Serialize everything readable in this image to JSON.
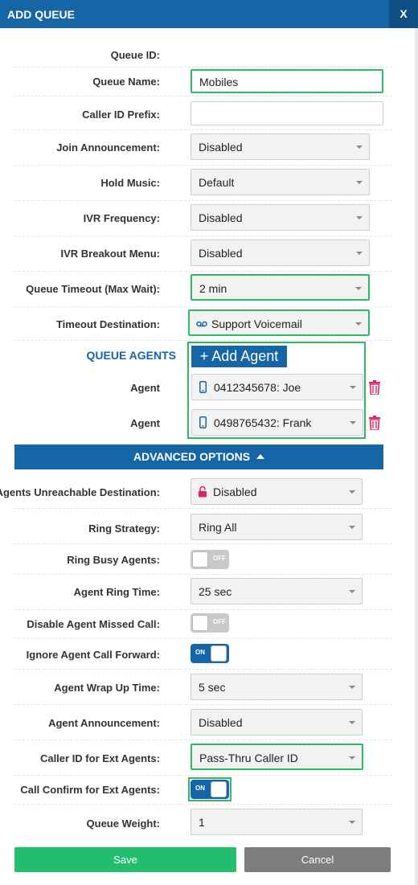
{
  "dialog": {
    "title": "ADD QUEUE",
    "close_label": "X"
  },
  "fields": {
    "queue_id": {
      "label": "Queue ID:"
    },
    "queue_name": {
      "label": "Queue Name:",
      "value": "Mobiles"
    },
    "caller_id_prefix": {
      "label": "Caller ID Prefix:",
      "value": ""
    },
    "join_announcement": {
      "label": "Join Announcement:",
      "value": "Disabled"
    },
    "hold_music": {
      "label": "Hold Music:",
      "value": "Default"
    },
    "ivr_frequency": {
      "label": "IVR Frequency:",
      "value": "Disabled"
    },
    "ivr_breakout_menu": {
      "label": "IVR Breakout Menu:",
      "value": "Disabled"
    },
    "queue_timeout": {
      "label": "Queue Timeout (Max Wait):",
      "value": "2 min"
    },
    "timeout_destination": {
      "label": "Timeout Destination:",
      "value": "Support Voicemail",
      "icon": "voicemail-icon"
    }
  },
  "agents": {
    "title": "QUEUE AGENTS",
    "add_label": "+ Add Agent",
    "list": [
      {
        "label": "Agent",
        "value": "0412345678: Joe",
        "icon": "mobile-phone-icon"
      },
      {
        "label": "Agent",
        "value": "0498765432: Frank",
        "icon": "mobile-phone-icon"
      }
    ]
  },
  "advanced": {
    "title": "ADVANCED OPTIONS",
    "agents_unreachable": {
      "label": "Agents Unreachable Destination:",
      "value": "Disabled",
      "icon": "lock-icon"
    },
    "ring_strategy": {
      "label": "Ring Strategy:",
      "value": "Ring All"
    },
    "ring_busy_agents": {
      "label": "Ring Busy Agents:",
      "state": "OFF"
    },
    "agent_ring_time": {
      "label": "Agent Ring Time:",
      "value": "25 sec"
    },
    "disable_agent_missed_call": {
      "label": "Disable Agent Missed Call:",
      "state": "OFF"
    },
    "ignore_agent_call_forward": {
      "label": "Ignore Agent Call Forward:",
      "state": "ON"
    },
    "agent_wrap_up_time": {
      "label": "Agent Wrap Up Time:",
      "value": "5 sec"
    },
    "agent_announcement": {
      "label": "Agent Announcement:",
      "value": "Disabled"
    },
    "caller_id_ext_agents": {
      "label": "Caller ID for Ext Agents:",
      "value": "Pass-Thru Caller ID"
    },
    "call_confirm_ext_agents": {
      "label": "Call Confirm for Ext Agents:",
      "state": "ON"
    },
    "queue_weight": {
      "label": "Queue Weight:",
      "value": "1"
    }
  },
  "buttons": {
    "save": "Save",
    "cancel": "Cancel"
  },
  "colors": {
    "primary": "#1565a7",
    "highlight": "#2fb866",
    "save": "#22bd6e",
    "cancel": "#7d7d7d",
    "delete": "#e0245e"
  }
}
